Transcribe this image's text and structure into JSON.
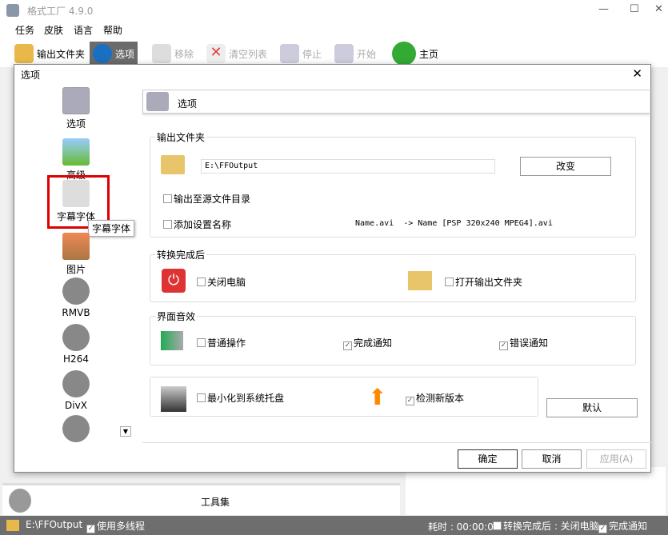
{
  "app": {
    "title": "格式工厂 4.9.0"
  },
  "menu": [
    "任务",
    "皮肤",
    "语言",
    "帮助"
  ],
  "toolbar": [
    {
      "label": "输出文件夹",
      "icon": "folder-icon",
      "enabled": true,
      "selected": false
    },
    {
      "label": "选项",
      "icon": "gear-icon",
      "enabled": true,
      "selected": true
    },
    {
      "label": "移除",
      "icon": "remove-icon",
      "enabled": false
    },
    {
      "label": "清空列表",
      "icon": "clear-list-icon",
      "enabled": false
    },
    {
      "label": "停止",
      "icon": "stop-icon",
      "enabled": false
    },
    {
      "label": "开始",
      "icon": "start-icon",
      "enabled": false
    },
    {
      "label": "主页",
      "icon": "home-globe-icon",
      "enabled": true
    }
  ],
  "dialog": {
    "title": "选项",
    "nav": [
      {
        "label": "选项"
      },
      {
        "label": "高级"
      },
      {
        "label": "字幕字体",
        "highlighted": true
      },
      {
        "label": "图片"
      },
      {
        "label": "RMVB"
      },
      {
        "label": "H264"
      },
      {
        "label": "DivX"
      },
      {
        "label": ""
      }
    ],
    "tooltip": "字幕字体",
    "header": "选项",
    "output": {
      "group": "输出文件夹",
      "path": "E:\\FFOutput",
      "change": "改变",
      "to_source": {
        "label": "输出至源文件目录",
        "checked": false
      },
      "add_name": {
        "label": "添加设置名称",
        "checked": false
      },
      "example": "Name.avi  -> Name [PSP 320x240 MPEG4].avi"
    },
    "after": {
      "group": "转换完成后",
      "shutdown": {
        "label": "关闭电脑",
        "checked": false
      },
      "open_folder": {
        "label": "打开输出文件夹",
        "checked": false
      }
    },
    "sound": {
      "group": "界面音效",
      "normal": {
        "label": "普通操作",
        "checked": false
      },
      "done": {
        "label": "完成通知",
        "checked": true
      },
      "error": {
        "label": "错误通知",
        "checked": true
      }
    },
    "misc": {
      "tray": {
        "label": "最小化到系统托盘",
        "checked": false
      },
      "update": {
        "label": "检测新版本",
        "checked": true
      }
    },
    "default": "默认",
    "ok": "确定",
    "cancel": "取消",
    "apply": "应用(A)"
  },
  "tools": "工具集",
  "status": {
    "path": "E:\\FFOutput",
    "multithread": "使用多线程",
    "elapsed": "耗时 : 00:00:00",
    "after": "转换完成后 : 关闭电脑",
    "notify": "完成通知"
  },
  "colors": {
    "highlight": "#e00000",
    "status_bg": "#6e6e6e",
    "selected_tool": "#6b6b6b"
  }
}
